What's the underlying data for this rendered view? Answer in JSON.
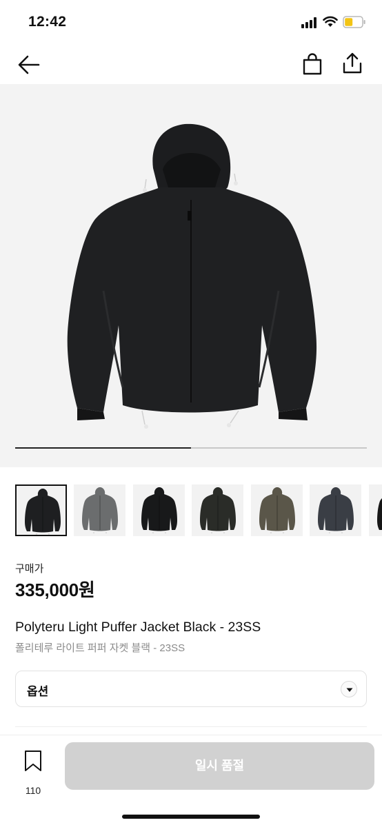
{
  "status_bar": {
    "time": "12:42"
  },
  "nav": {
    "back_label": "back",
    "bag_label": "shopping bag",
    "share_label": "share"
  },
  "gallery": {
    "progress_fraction": 0.5,
    "thumbnails": [
      {
        "name": "thumb-1-black",
        "jacket_color": "#1e1f21",
        "selected": true
      },
      {
        "name": "thumb-2-gray",
        "jacket_color": "#6b6d6e",
        "selected": false
      },
      {
        "name": "thumb-3-black",
        "jacket_color": "#18191a",
        "selected": false
      },
      {
        "name": "thumb-4-darkgreen",
        "jacket_color": "#2a2c28",
        "selected": false
      },
      {
        "name": "thumb-5-olive",
        "jacket_color": "#5a5649",
        "selected": false
      },
      {
        "name": "thumb-6-navy",
        "jacket_color": "#3a3e45",
        "selected": false
      },
      {
        "name": "thumb-7-black",
        "jacket_color": "#161616",
        "selected": false
      }
    ]
  },
  "product": {
    "price_label": "구매가",
    "price": "335,000원",
    "name_en": "Polyteru Light Puffer Jacket Black - 23SS",
    "name_ko": "폴리테루 라이트 퍼퍼 자켓 블랙 - 23SS"
  },
  "option": {
    "label": "옵션"
  },
  "bottom_bar": {
    "wish_count": "110",
    "buy_label": "일시 품절"
  },
  "colors": {
    "buy_button_disabled": "#d1d1d1",
    "jacket_main": "#1f2022"
  }
}
